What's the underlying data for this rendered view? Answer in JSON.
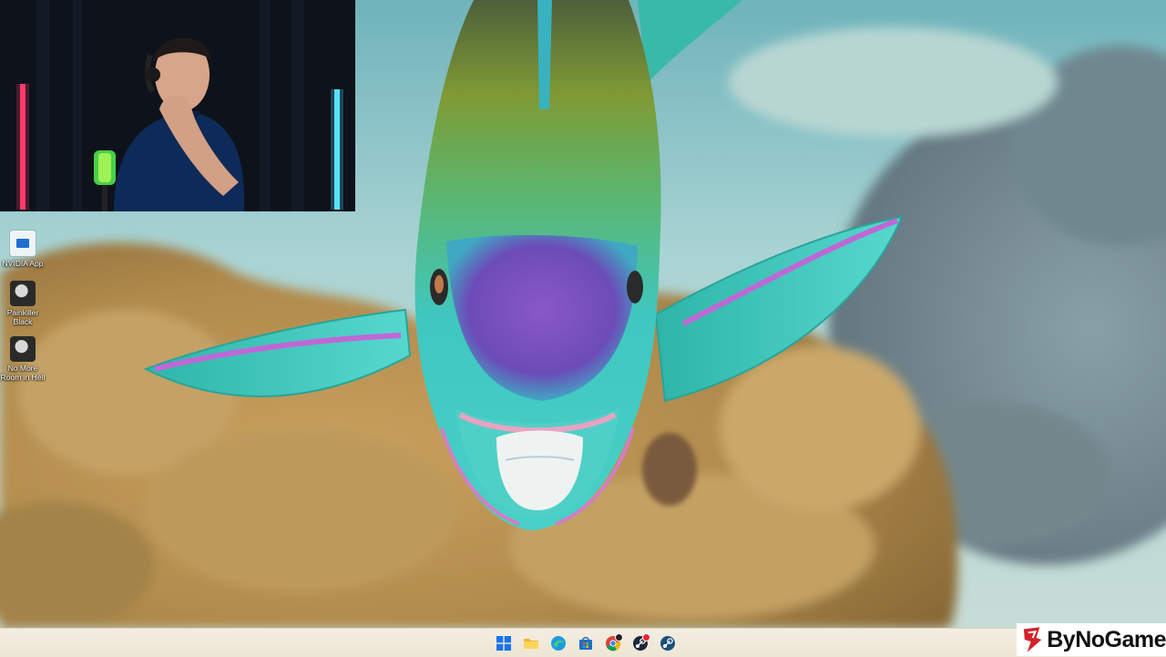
{
  "desktop": {
    "icons": [
      {
        "label": "NVIDIA App",
        "icon": "nvidia-app-icon"
      },
      {
        "label": "Painkiller\nBlack",
        "icon": "painkiller-icon"
      },
      {
        "label": "No More\nRoom in Hell",
        "icon": "no-more-room-icon"
      }
    ]
  },
  "taskbar": {
    "apps": [
      "windows-start-icon",
      "file-explorer-icon",
      "edge-icon",
      "microsoft-store-icon",
      "chrome-icon",
      "steam-icon",
      "steam-icon"
    ]
  },
  "watermark": {
    "text": "ByNoGame",
    "logo": "bynogame-logo-icon"
  },
  "colors": {
    "taskbar_bg": "#f0e9d9",
    "fish_body": "#3fc7c0",
    "fish_face": "#7a55c8",
    "water": "#8ec4c8"
  }
}
